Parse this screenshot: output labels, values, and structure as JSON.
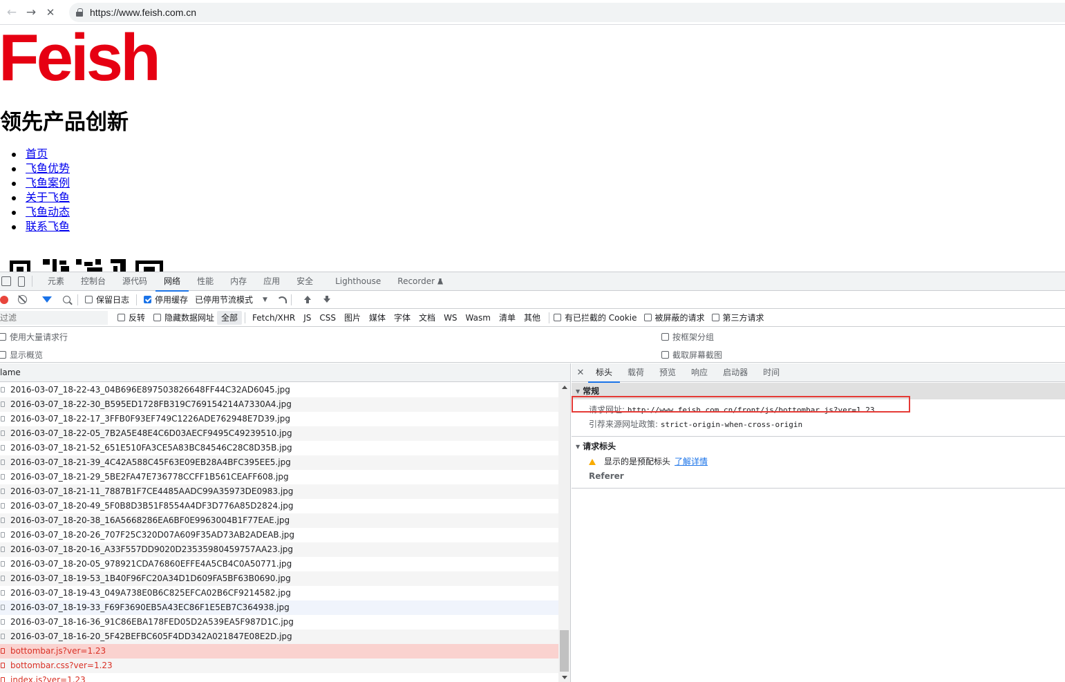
{
  "browser": {
    "url": "https://www.feish.com.cn",
    "back_glyph": "←",
    "forward_glyph": "→",
    "stop_glyph": "✕"
  },
  "page": {
    "logo_text": "Feish",
    "logo_color": "#e60012",
    "headline": "领先产品创新",
    "nav_links": [
      "首页",
      "飞鱼优势",
      "飞鱼案例",
      "关于飞鱼",
      "飞鱼动态",
      "联系飞鱼"
    ]
  },
  "devtools": {
    "tabs": [
      "元素",
      "控制台",
      "源代码",
      "网络",
      "性能",
      "内存",
      "应用",
      "安全",
      "Lighthouse",
      "Recorder"
    ],
    "active_tab": "网络",
    "toolbar": {
      "preserve_log": "保留日志",
      "disable_cache": "停用缓存",
      "throttle": "已停用节流模式",
      "caret": "▼"
    },
    "filterbar": {
      "placeholder": "过滤",
      "invert": "反转",
      "hide_data_urls": "隐藏数据网址",
      "types": [
        "全部",
        "Fetch/XHR",
        "JS",
        "CSS",
        "图片",
        "媒体",
        "字体",
        "文档",
        "WS",
        "Wasm",
        "清单",
        "其他"
      ],
      "blocked_cookies": "有已拦截的 Cookie",
      "blocked_requests": "被屏蔽的请求",
      "third_party": "第三方请求"
    },
    "options": {
      "large_rows": "使用大量请求行",
      "group_by_frame": "按框架分组",
      "show_overview": "显示概览",
      "capture_screenshots": "截取屏幕截图"
    },
    "request_list": {
      "column_name": "lame",
      "rows": [
        {
          "name": "2016-03-07_18-22-43_04B696E897503826648FF44C32AD6045.jpg",
          "state": "normal"
        },
        {
          "name": "2016-03-07_18-22-30_B595ED1728FB319C769154214A7330A4.jpg",
          "state": "normal"
        },
        {
          "name": "2016-03-07_18-22-17_3FFB0F93EF749C1226ADE762948E7D39.jpg",
          "state": "normal"
        },
        {
          "name": "2016-03-07_18-22-05_7B2A5E48E4C6D03AECF9495C49239510.jpg",
          "state": "normal"
        },
        {
          "name": "2016-03-07_18-21-52_651E510FA3CE5A83BC84546C28C8D35B.jpg",
          "state": "normal"
        },
        {
          "name": "2016-03-07_18-21-39_4C42A588C45F63E09EB28A4BFC395EE5.jpg",
          "state": "normal"
        },
        {
          "name": "2016-03-07_18-21-29_5BE2FA47E736778CCFF1B561CEAFF608.jpg",
          "state": "normal"
        },
        {
          "name": "2016-03-07_18-21-11_7887B1F7CE4485AADC99A35973DE0983.jpg",
          "state": "normal"
        },
        {
          "name": "2016-03-07_18-20-49_5F0B8D3B51F8554A4DF3D776A85D2824.jpg",
          "state": "normal"
        },
        {
          "name": "2016-03-07_18-20-38_16A5668286EA6BF0E9963004B1F77EAE.jpg",
          "state": "normal"
        },
        {
          "name": "2016-03-07_18-20-26_707F25C320D07A609F35AD73AB2ADEAB.jpg",
          "state": "normal"
        },
        {
          "name": "2016-03-07_18-20-16_A33F557DD9020D23535980459757AA23.jpg",
          "state": "normal"
        },
        {
          "name": "2016-03-07_18-20-05_978921CDA76860EFFE4A5CB4C0A50771.jpg",
          "state": "normal"
        },
        {
          "name": "2016-03-07_18-19-53_1B40F96FC20A34D1D609FA5BF63B0690.jpg",
          "state": "normal"
        },
        {
          "name": "2016-03-07_18-19-43_049A738E0B6C825EFCA02B6CF9214582.jpg",
          "state": "normal"
        },
        {
          "name": "2016-03-07_18-19-33_F69F3690EB5A43EC86F1E5EB7C364938.jpg",
          "state": "hover"
        },
        {
          "name": "2016-03-07_18-16-36_91C86EBA178FED05D2A539EA5F987D1C.jpg",
          "state": "normal"
        },
        {
          "name": "2016-03-07_18-16-20_5F42BEFBC605F4DD342A021847E08E2D.jpg",
          "state": "normal"
        },
        {
          "name": "bottombar.js?ver=1.23",
          "state": "selected-error"
        },
        {
          "name": "bottombar.css?ver=1.23",
          "state": "error"
        },
        {
          "name": "index.js?ver=1.23",
          "state": "error"
        }
      ]
    },
    "details": {
      "close_glyph": "✕",
      "tabs": [
        "标头",
        "载荷",
        "预览",
        "响应",
        "启动器",
        "时间"
      ],
      "active_tab": "标头",
      "general_title": "常规",
      "request_url_key": "请求网址:",
      "request_url_value": "http://www.feish.com.cn/front/js/bottombar.js?ver=1.23",
      "referrer_policy_key": "引荐来源网址政策:",
      "referrer_policy_value": "strict-origin-when-cross-origin",
      "request_headers_title": "请求标头",
      "provisional_warning": "显示的是预配标头",
      "learn_more": "了解详情",
      "referer_label": "Referer",
      "triangle_glyph": "▼"
    }
  }
}
